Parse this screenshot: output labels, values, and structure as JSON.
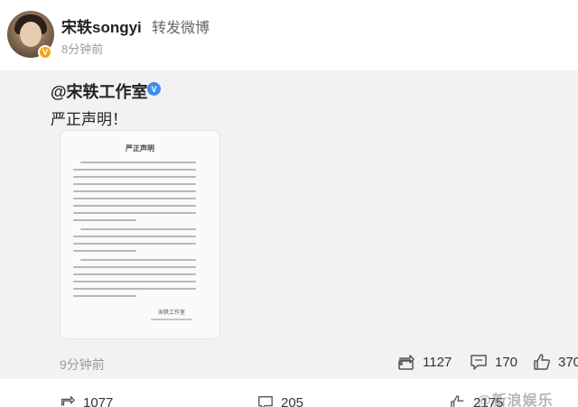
{
  "header": {
    "user_name": "宋轶songyi",
    "action": "转发微博",
    "time": "8分钟前",
    "badge": "V"
  },
  "original": {
    "mention": "@宋轶工作室",
    "verified_badge": "V",
    "text": "严正声明！",
    "doc_title": "严正声明",
    "doc_signature": "宋轶工作室",
    "time": "9分钟前",
    "stats": {
      "reposts": "1127",
      "comments": "170",
      "likes": "370"
    }
  },
  "footer": {
    "reposts": "1077",
    "comments": "205",
    "likes": "2175",
    "watermark": "@新浪娱乐"
  },
  "colors": {
    "accent_orange": "#f7a11a",
    "verified_blue": "#3d8ee8",
    "card_bg": "#f2f2f2"
  },
  "icons": [
    "repost-icon",
    "comment-icon",
    "like-icon"
  ]
}
